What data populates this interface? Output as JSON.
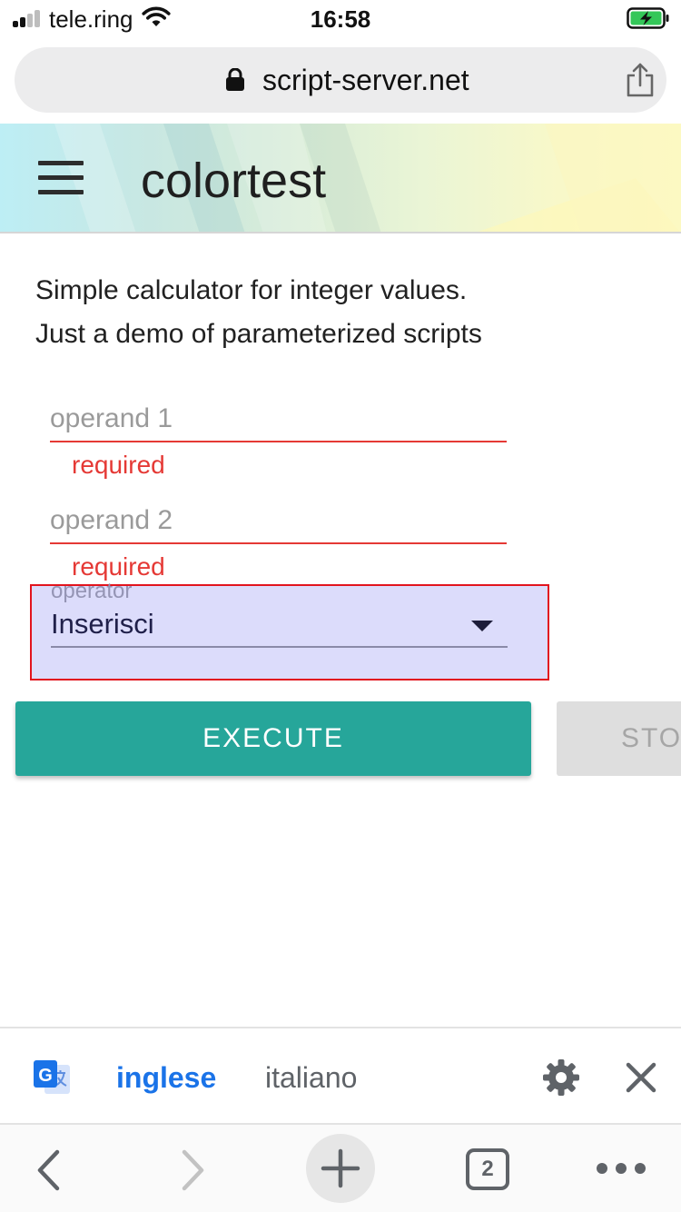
{
  "status_bar": {
    "carrier": "tele.ring",
    "time": "16:58",
    "battery_charging": true
  },
  "url_bar": {
    "url": "script-server.net",
    "icons": [
      "lock-icon",
      "share-icon"
    ]
  },
  "header": {
    "title": "colortest",
    "icons": [
      "hamburger-menu-icon"
    ]
  },
  "content": {
    "description_line1": "Simple calculator for integer values.",
    "description_line2": "Just a demo of parameterized scripts",
    "operand1": {
      "placeholder": "operand 1",
      "error": "required"
    },
    "operand2": {
      "placeholder": "operand 2",
      "error": "required"
    },
    "operator": {
      "label": "operator",
      "value": "Inserisci"
    },
    "execute_label": "EXECUTE",
    "stop_label": "STOP"
  },
  "translate_bar": {
    "active_language": "inglese",
    "inactive_language": "italiano",
    "icons": [
      "google-translate-icon",
      "gear-icon",
      "close-icon"
    ]
  },
  "toolbar": {
    "tabs_count": "2",
    "icons": [
      "back-icon",
      "forward-icon",
      "new-tab-icon",
      "tabs-icon",
      "more-icon"
    ]
  },
  "colors": {
    "accent": "#26a69a",
    "error": "#e53935",
    "translate_active": "#1a73e8",
    "highlight_fill": "#dcdcfb",
    "highlight_border": "#e2141e"
  }
}
